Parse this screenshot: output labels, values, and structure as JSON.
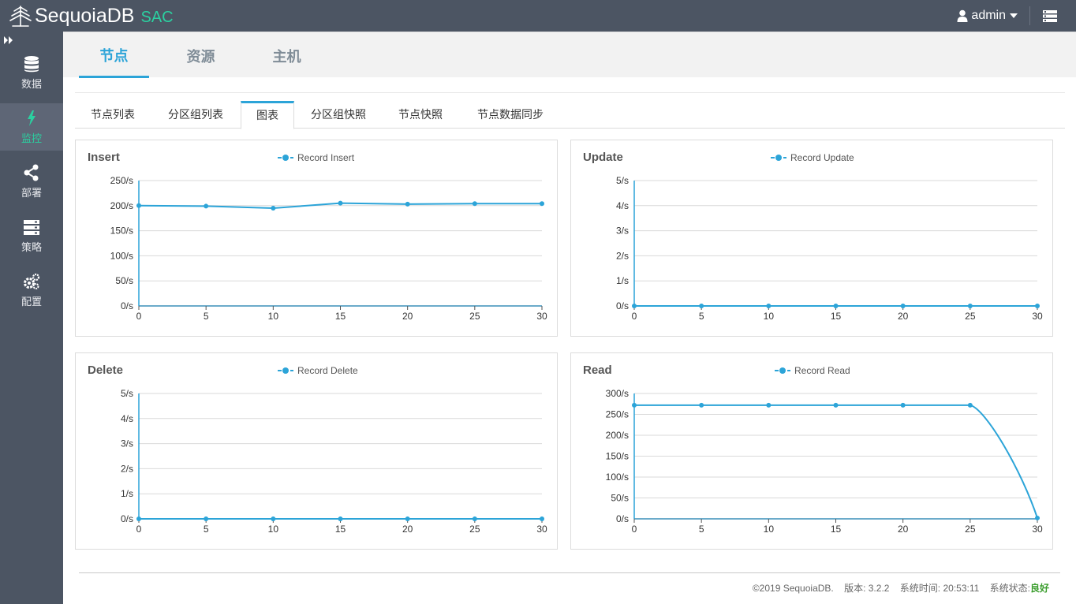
{
  "app": {
    "logo_text": "SequoiaDB",
    "logo_suffix": "SAC",
    "user": "admin"
  },
  "sidebar": {
    "items": [
      {
        "label": "数据",
        "icon": "database-icon"
      },
      {
        "label": "监控",
        "icon": "lightning-icon",
        "active": true
      },
      {
        "label": "部署",
        "icon": "share-icon"
      },
      {
        "label": "策略",
        "icon": "server-icon"
      },
      {
        "label": "配置",
        "icon": "gears-icon"
      }
    ]
  },
  "top_tabs": [
    "节点",
    "资源",
    "主机"
  ],
  "sub_tabs": [
    "节点列表",
    "分区组列表",
    "图表",
    "分区组快照",
    "节点快照",
    "节点数据同步"
  ],
  "colors": {
    "accent": "#2ca4d8",
    "line": "#2ca4d8",
    "header_bg": "#4c5563",
    "status_good": "#3c9e2f"
  },
  "chart_data": [
    {
      "type": "line",
      "title": "Insert",
      "series": [
        {
          "name": "Record Insert",
          "x": [
            0,
            5,
            10,
            15,
            20,
            25,
            30
          ],
          "values": [
            200,
            199,
            195,
            205,
            203,
            204,
            204
          ]
        }
      ],
      "xticks": [
        "0",
        "5",
        "10",
        "15",
        "20",
        "25",
        "30"
      ],
      "yticks": [
        "0/s",
        "50/s",
        "100/s",
        "150/s",
        "200/s",
        "250/s"
      ],
      "ylim": [
        0,
        250
      ],
      "xlim": [
        0,
        30
      ],
      "grid": true,
      "legend": "top-center"
    },
    {
      "type": "line",
      "title": "Update",
      "series": [
        {
          "name": "Record Update",
          "x": [
            0,
            5,
            10,
            15,
            20,
            25,
            30
          ],
          "values": [
            0,
            0,
            0,
            0,
            0,
            0,
            0
          ]
        }
      ],
      "xticks": [
        "0",
        "5",
        "10",
        "15",
        "20",
        "25",
        "30"
      ],
      "yticks": [
        "0/s",
        "1/s",
        "2/s",
        "3/s",
        "4/s",
        "5/s"
      ],
      "ylim": [
        0,
        5
      ],
      "xlim": [
        0,
        30
      ],
      "grid": true,
      "legend": "top-center"
    },
    {
      "type": "line",
      "title": "Delete",
      "series": [
        {
          "name": "Record Delete",
          "x": [
            0,
            5,
            10,
            15,
            20,
            25,
            30
          ],
          "values": [
            0,
            0,
            0,
            0,
            0,
            0,
            0
          ]
        }
      ],
      "xticks": [
        "0",
        "5",
        "10",
        "15",
        "20",
        "25",
        "30"
      ],
      "yticks": [
        "0/s",
        "1/s",
        "2/s",
        "3/s",
        "4/s",
        "5/s"
      ],
      "ylim": [
        0,
        5
      ],
      "xlim": [
        0,
        30
      ],
      "grid": true,
      "legend": "top-center"
    },
    {
      "type": "line",
      "title": "Read",
      "series": [
        {
          "name": "Record Read",
          "x": [
            0,
            5,
            10,
            15,
            20,
            25,
            30
          ],
          "values": [
            272,
            272,
            272,
            272,
            272,
            272,
            2
          ]
        }
      ],
      "xticks": [
        "0",
        "5",
        "10",
        "15",
        "20",
        "25",
        "30"
      ],
      "yticks": [
        "0/s",
        "50/s",
        "100/s",
        "150/s",
        "200/s",
        "250/s",
        "300/s"
      ],
      "ylim": [
        0,
        300
      ],
      "xlim": [
        0,
        30
      ],
      "grid": true,
      "legend": "top-center"
    }
  ],
  "footer": {
    "copyright": "©2019 SequoiaDB.",
    "version": "版本: 3.2.2",
    "time": "系统时间: 20:53:11",
    "status_label": "系统状态:",
    "status_value": "良好"
  }
}
